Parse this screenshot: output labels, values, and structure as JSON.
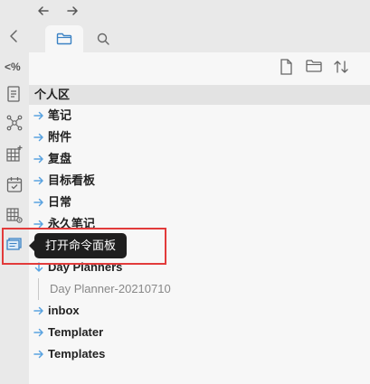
{
  "nav": {
    "back_symbol": "←",
    "forward_symbol": "→"
  },
  "tabs": [
    {
      "name": "files",
      "icon": "folder-icon"
    },
    {
      "name": "search",
      "icon": "search-icon"
    }
  ],
  "ribbon": {
    "collapse_icon": "chevron-left-icon",
    "items": [
      {
        "label": "<%",
        "icon": "templater-icon"
      },
      {
        "icon": "document-icon"
      },
      {
        "icon": "graph-icon"
      },
      {
        "icon": "grid-plus-icon"
      },
      {
        "icon": "calendar-check-icon"
      },
      {
        "icon": "table-gear-icon"
      },
      {
        "icon": "command-palette-icon",
        "accent": "#3b82c4"
      }
    ]
  },
  "toolbar": {
    "actions": [
      "new-note-icon",
      "new-folder-icon",
      "sort-icon"
    ]
  },
  "tree": {
    "root": "个人区",
    "items": [
      {
        "label": "笔记",
        "type": "folder"
      },
      {
        "label": "附件",
        "type": "folder"
      },
      {
        "label": "复盘",
        "type": "folder"
      },
      {
        "label": "目标看板",
        "type": "folder"
      },
      {
        "label": "日常",
        "type": "folder"
      },
      {
        "label": "永久笔记",
        "type": "folder"
      },
      {
        "label": "",
        "type": "folder-hidden"
      },
      {
        "label": "Day Planners",
        "type": "folder-open"
      },
      {
        "label": "Day Planner-20210710",
        "type": "file"
      },
      {
        "label": "inbox",
        "type": "folder"
      },
      {
        "label": "Templater",
        "type": "folder"
      },
      {
        "label": "Templates",
        "type": "folder"
      }
    ]
  },
  "tooltip": {
    "text": "打开命令面板"
  },
  "colors": {
    "accent": "#5aa3e0",
    "highlight": "#e23b3b"
  }
}
